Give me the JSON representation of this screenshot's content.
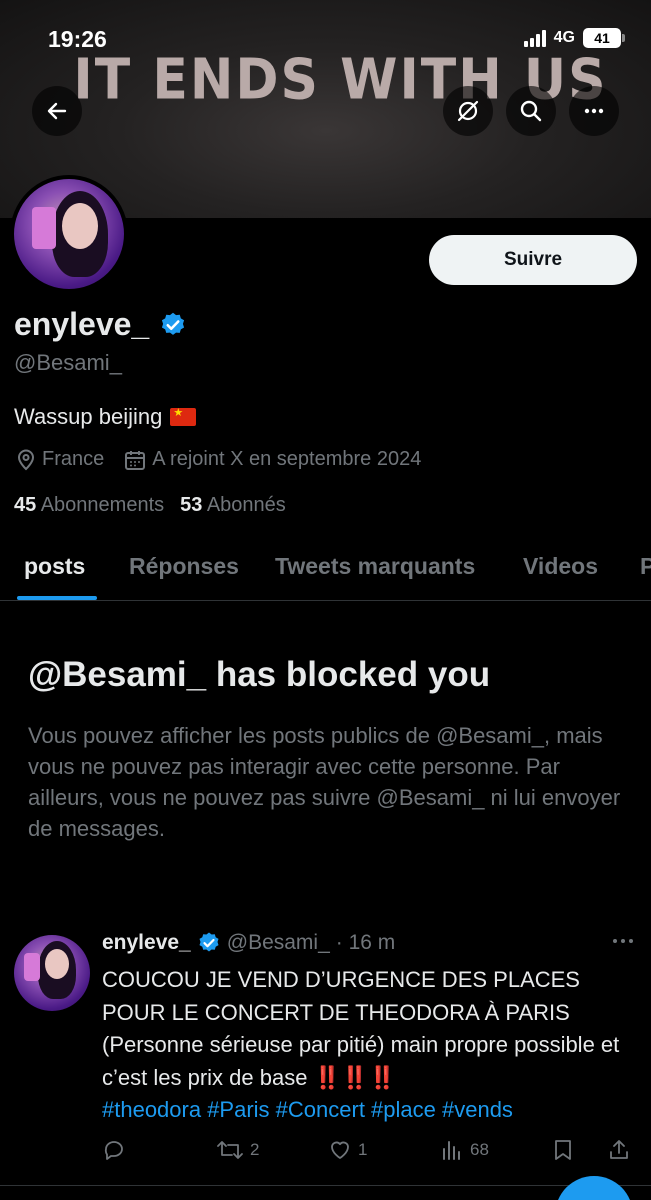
{
  "status_bar": {
    "time": "19:26",
    "network": "4G",
    "battery": "41"
  },
  "banner": {
    "title": "IT ENDS WITH US"
  },
  "header": {
    "back_icon": "arrow-left-icon",
    "grok_icon": "grok-icon",
    "search_icon": "search-icon",
    "more_icon": "more-horizontal-icon"
  },
  "profile": {
    "follow_label": "Suivre",
    "display_name": "enyleve_",
    "handle": "@Besami_",
    "bio": "Wassup beijing",
    "location": "France",
    "joined": "A rejoint X en septembre 2024",
    "following_count": "45",
    "following_label": "Abonnements",
    "followers_count": "53",
    "followers_label": "Abonnés"
  },
  "tabs": [
    {
      "label": "posts",
      "active": true
    },
    {
      "label": "Réponses"
    },
    {
      "label": "Tweets marquants"
    },
    {
      "label": "Videos"
    },
    {
      "label": "P"
    }
  ],
  "blocked": {
    "title": "@Besami_ has blocked you",
    "message": "Vous pouvez afficher les posts publics de @Besami_, mais vous ne pouvez pas interagir avec cette personne. Par ailleurs, vous ne pouvez pas suivre @Besami_ ni lui envoyer de messages."
  },
  "tweet": {
    "name": "enyleve_",
    "handle": "@Besami_",
    "time": "· 16 m",
    "text": "COUCOU JE VEND D’URGENCE DES PLACES POUR LE CONCERT DE THEODORA À PARIS (Personne sérieuse par pitié) main propre possible et c’est les prix de base",
    "emphasis": "‼️ ‼️ ‼️",
    "hashtags": "#theodora #Paris #Concert #place #vends",
    "replies": "",
    "retweets": "2",
    "likes": "1",
    "views": "68"
  },
  "colors": {
    "accent": "#1d9bf0",
    "background": "#000000",
    "muted": "#71767b",
    "text": "#e7e9ea"
  }
}
